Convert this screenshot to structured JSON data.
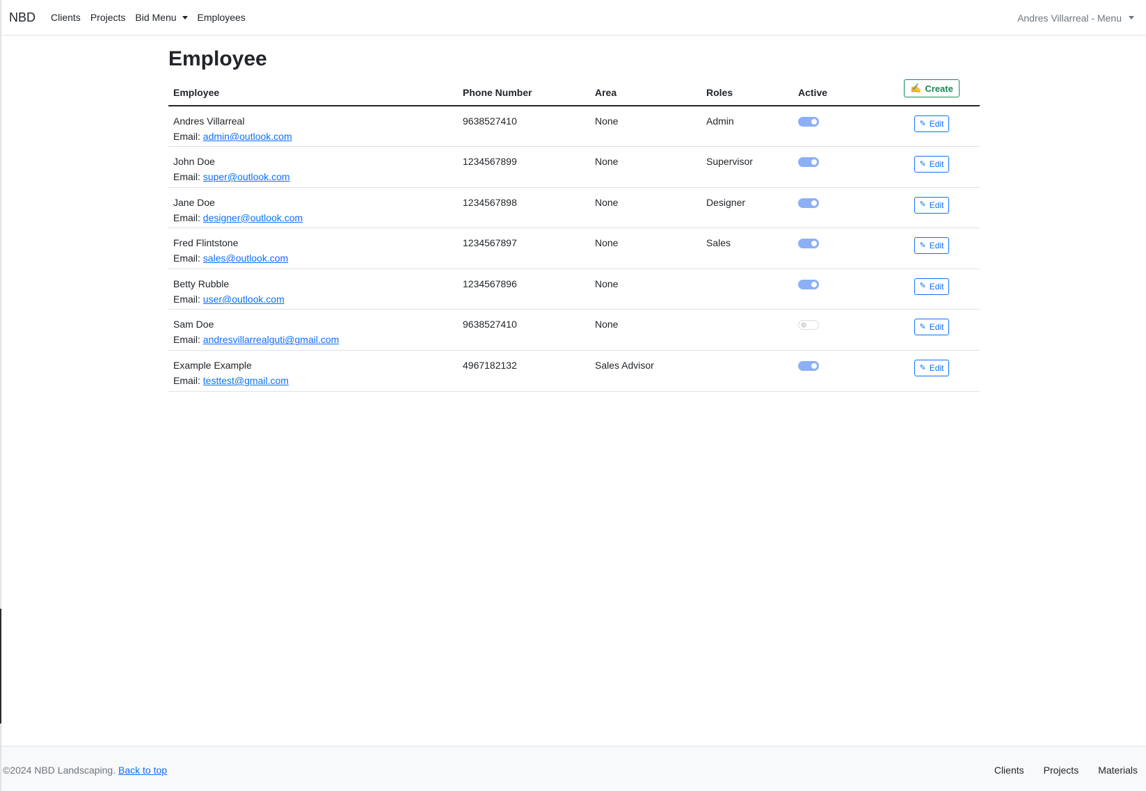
{
  "navbar": {
    "brand": "NBD",
    "links": [
      "Clients",
      "Projects",
      "Bid Menu",
      "Employees"
    ],
    "user_menu": "Andres Villarreal - Menu"
  },
  "page": {
    "title": "Employee"
  },
  "table": {
    "headers": [
      "Employee",
      "Phone Number",
      "Area",
      "Roles",
      "Active"
    ],
    "create_label": "Create",
    "edit_label": "Edit",
    "email_prefix": "Email:",
    "rows": [
      {
        "name": "Andres Villarreal",
        "email": "admin@outlook.com",
        "phone": "9638527410",
        "area": "None",
        "role": "Admin",
        "active": true
      },
      {
        "name": "John Doe",
        "email": "super@outlook.com",
        "phone": "1234567899",
        "area": "None",
        "role": "Supervisor",
        "active": true
      },
      {
        "name": "Jane Doe",
        "email": "designer@outlook.com",
        "phone": "1234567898",
        "area": "None",
        "role": "Designer",
        "active": true
      },
      {
        "name": "Fred Flintstone",
        "email": "sales@outlook.com",
        "phone": "1234567897",
        "area": "None",
        "role": "Sales",
        "active": true
      },
      {
        "name": "Betty Rubble",
        "email": "user@outlook.com",
        "phone": "1234567896",
        "area": "None",
        "role": "",
        "active": true
      },
      {
        "name": "Sam Doe",
        "email": "andresvillarrealguti@gmail.com",
        "phone": "9638527410",
        "area": "None",
        "role": "",
        "active": false
      },
      {
        "name": "Example Example",
        "email": "testtest@gmail.com",
        "phone": "4967182132",
        "area": "Sales Advisor",
        "role": "",
        "active": true
      }
    ]
  },
  "footer": {
    "copyright": "©2024 NBD Landscaping.",
    "back_to_top": "Back to top",
    "links": [
      "Clients",
      "Projects",
      "Materials"
    ]
  },
  "colors": {
    "primary": "#0d6efd",
    "success": "#198754",
    "toggle_on": "#8bb0f5"
  }
}
